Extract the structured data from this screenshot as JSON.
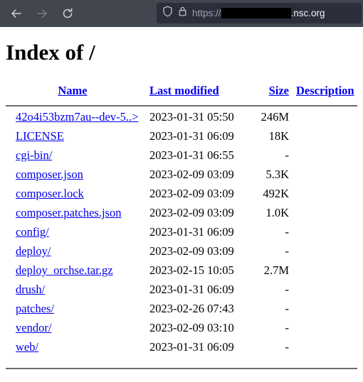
{
  "browser": {
    "back_icon": "arrow-left-icon",
    "forward_icon": "arrow-right-icon",
    "reload_icon": "reload-icon",
    "shield_icon": "shield-icon",
    "lock_icon": "padlock-icon",
    "url_scheme": "https://",
    "url_redacted": "",
    "url_host": ".nsc.org"
  },
  "page": {
    "title": "Index of /"
  },
  "table": {
    "headers": {
      "name": "Name",
      "last_modified": "Last modified",
      "size": "Size",
      "description": "Description"
    },
    "rows": [
      {
        "name": "42o4i53bzm7au--dev-5..>",
        "last_modified": "2023-01-31 05:50",
        "size": "246M",
        "description": ""
      },
      {
        "name": "LICENSE",
        "last_modified": "2023-01-31 06:09",
        "size": "18K",
        "description": ""
      },
      {
        "name": "cgi-bin/",
        "last_modified": "2023-01-31 06:55",
        "size": "-",
        "description": ""
      },
      {
        "name": "composer.json",
        "last_modified": "2023-02-09 03:09",
        "size": "5.3K",
        "description": ""
      },
      {
        "name": "composer.lock",
        "last_modified": "2023-02-09 03:09",
        "size": "492K",
        "description": ""
      },
      {
        "name": "composer.patches.json",
        "last_modified": "2023-02-09 03:09",
        "size": "1.0K",
        "description": ""
      },
      {
        "name": "config/",
        "last_modified": "2023-01-31 06:09",
        "size": "-",
        "description": ""
      },
      {
        "name": "deploy/",
        "last_modified": "2023-02-09 03:09",
        "size": "-",
        "description": ""
      },
      {
        "name": "deploy_orchse.tar.gz",
        "last_modified": "2023-02-15 10:05",
        "size": "2.7M",
        "description": ""
      },
      {
        "name": "drush/",
        "last_modified": "2023-01-31 06:09",
        "size": "-",
        "description": ""
      },
      {
        "name": "patches/",
        "last_modified": "2023-02-26 07:43",
        "size": "-",
        "description": ""
      },
      {
        "name": "vendor/",
        "last_modified": "2023-02-09 03:10",
        "size": "-",
        "description": ""
      },
      {
        "name": "web/",
        "last_modified": "2023-01-31 06:09",
        "size": "-",
        "description": ""
      }
    ]
  },
  "colors": {
    "link": "#0000ee",
    "toolbar_bg": "#42464f",
    "urlbar_bg": "#2b2e3b",
    "page_bg": "#ffffff",
    "rule": "#6b6b6b"
  }
}
